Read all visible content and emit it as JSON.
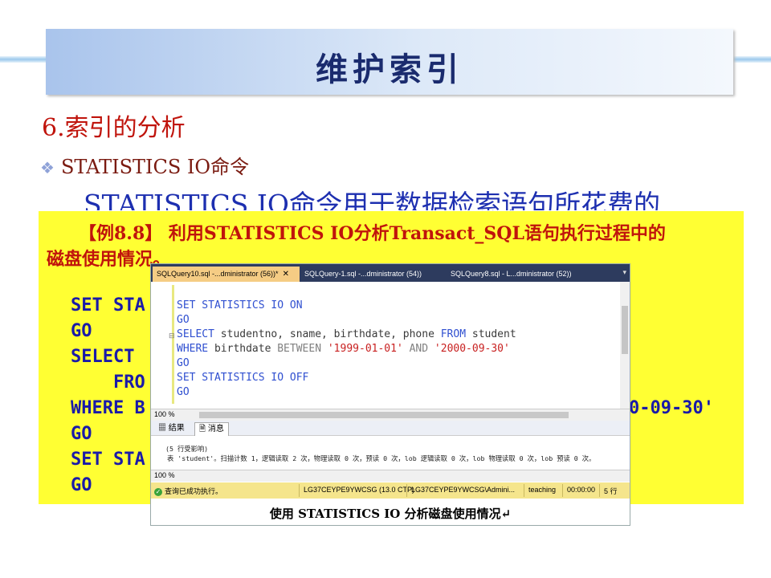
{
  "slide": {
    "title": "维护索引",
    "heading": "6.索引的分析",
    "bullet": "STATISTICS IO命令",
    "big_text": "STATISTICS IO命令用于数据检索语句所花费的"
  },
  "example": {
    "line1": "【例8.8】 利用STATISTICS IO分析Transact_SQL语句执行过程中的",
    "line2": "磁盘使用情况。",
    "code": [
      "SET STA",
      "GO",
      "SELECT",
      "    FRO",
      "WHERE B",
      "GO",
      "SET STA",
      "GO"
    ],
    "code_overflow": "0-09-30'"
  },
  "screenshot": {
    "tabs": [
      {
        "label": "SQLQuery10.sql -...dministrator (56))*",
        "active": true
      },
      {
        "label": "SQLQuery-1.sql -...dministrator (54))",
        "active": false
      },
      {
        "label": "SQLQuery8.sql - L...dministrator (52))",
        "active": false
      }
    ],
    "editor": {
      "l1": "SET STATISTICS IO ON",
      "l2": "GO",
      "l3_kw": "SELECT",
      "l3_rest": " studentno, sname, birthdate, phone ",
      "l3_kw2": "FROM",
      "l3_rest2": " student",
      "l4_kw": "WHERE",
      "l4_rest": " birthdate ",
      "l4_kw2": "BETWEEN",
      "l4_str1": " '1999-01-01'",
      "l4_and": " AND",
      "l4_str2": " '2000-09-30'",
      "l5": "GO",
      "l6": "SET STATISTICS IO OFF",
      "l7": "GO"
    },
    "zoom1": "100 %",
    "result_tabs": [
      "结果",
      "消息"
    ],
    "messages": [
      "(5 行受影响)",
      "表 'student'。扫描计数 1，逻辑读取 2 次，物理读取 0 次，预读 0 次，lob 逻辑读取 0 次，lob 物理读取 0 次，lob 预读 0 次。"
    ],
    "zoom2": "100 %",
    "status": {
      "msg": "查询已成功执行。",
      "server": "LG37CEYPE9YWCSG (13.0 CTP)",
      "user": "LG37CEYPE9YWCSG\\Admini...",
      "db": "teaching",
      "time": "00:00:00",
      "rows": "5 行"
    },
    "caption": "使用 STATISTICS IO 分析磁盘使用情况↵"
  },
  "colors": {
    "title": "#1a2b6e",
    "heading": "#c0140c",
    "code": "#1a1aa8",
    "highlight": "#ffff33"
  }
}
